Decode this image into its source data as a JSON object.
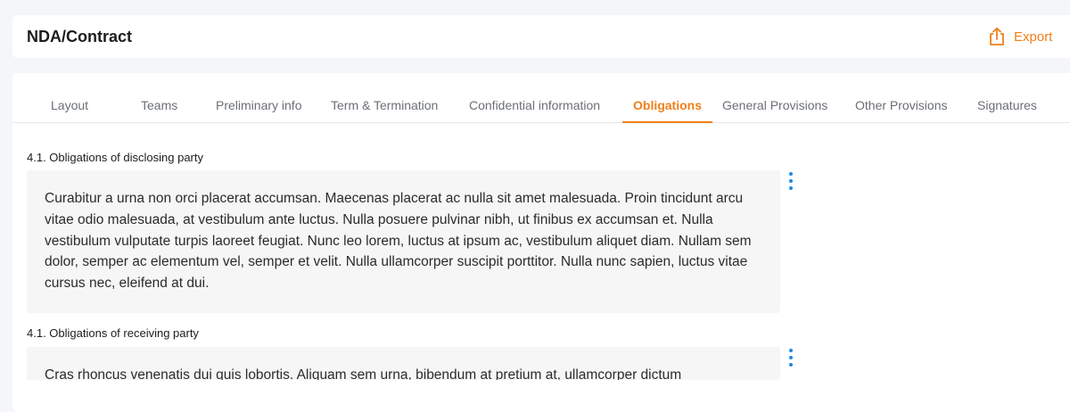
{
  "header": {
    "title": "NDA/Contract",
    "export_label": "Export"
  },
  "tabs": [
    {
      "label": "Layout"
    },
    {
      "label": "Teams"
    },
    {
      "label": "Preliminary info"
    },
    {
      "label": "Term & Termination"
    },
    {
      "label": "Confidential information"
    },
    {
      "label": "Obligations"
    },
    {
      "label": "General Provisions"
    },
    {
      "label": "Other Provisions"
    },
    {
      "label": "Signatures"
    }
  ],
  "active_tab": "Obligations",
  "sections": [
    {
      "title": "4.1. Obligations of disclosing party",
      "text": "Curabitur a urna non orci placerat accumsan. Maecenas placerat ac nulla sit amet malesuada. Proin tincidunt arcu vitae odio malesuada, at vestibulum ante luctus. Nulla posuere pulvinar nibh, ut finibus ex accumsan et. Nulla vestibulum vulputate turpis laoreet feugiat. Nunc leo lorem, luctus at ipsum ac, vestibulum aliquet diam. Nullam sem dolor, semper ac elementum vel, semper et velit. Nulla ullamcorper suscipit porttitor. Nulla nunc sapien, luctus vitae cursus nec, eleifend at dui."
    },
    {
      "title": "4.1. Obligations of receiving party",
      "text": "Cras rhoncus venenatis dui quis lobortis. Aliquam sem urna, bibendum at pretium at, ullamcorper dictum"
    }
  ],
  "colors": {
    "accent": "#f07f1a",
    "menu_icon": "#1e88e5"
  },
  "icons": {
    "export": "export-icon",
    "more": "more-vertical-icon"
  }
}
